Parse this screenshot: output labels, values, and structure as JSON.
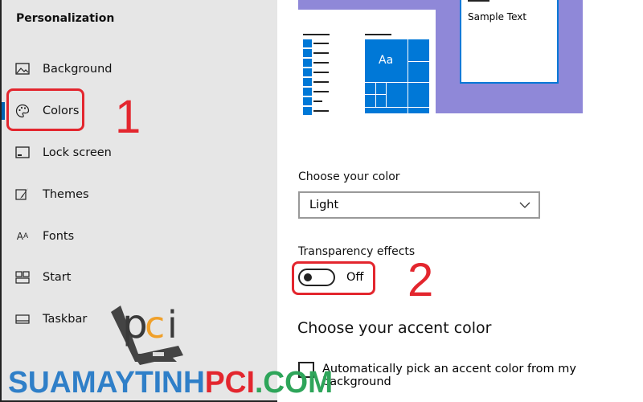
{
  "sidebar": {
    "title": "Personalization",
    "items": [
      {
        "label": "Background",
        "icon": "picture-icon"
      },
      {
        "label": "Colors",
        "icon": "palette-icon",
        "selected": true
      },
      {
        "label": "Lock screen",
        "icon": "lock-screen-icon"
      },
      {
        "label": "Themes",
        "icon": "brush-icon"
      },
      {
        "label": "Fonts",
        "icon": "fonts-icon"
      },
      {
        "label": "Start",
        "icon": "start-icon"
      },
      {
        "label": "Taskbar",
        "icon": "taskbar-icon"
      }
    ]
  },
  "annotations": {
    "step1": "1",
    "step2": "2",
    "color": "#e3262e"
  },
  "preview": {
    "sample_text": "Sample Text",
    "tile_text": "Aa",
    "accent": "#0078d7",
    "background": "#8f88d8"
  },
  "main": {
    "choose_color_label": "Choose your color",
    "choose_color_value": "Light",
    "transparency_label": "Transparency effects",
    "transparency_state": "Off",
    "accent_heading": "Choose your accent color",
    "auto_pick_label": "Automatically pick an accent color from my background",
    "auto_pick_checked": false
  },
  "watermark": {
    "part1": "SUAMAYTINH",
    "part2": "PCI",
    "part3": ".COM",
    "logo": "pci"
  }
}
